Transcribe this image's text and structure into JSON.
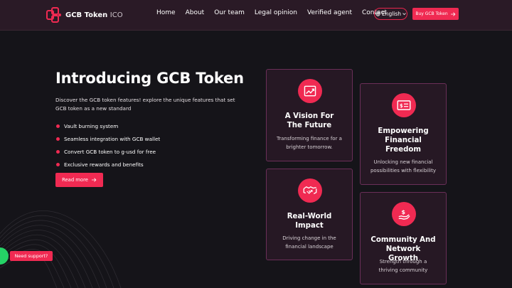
{
  "brand": {
    "name": "GCB Token",
    "suffix": "ICO"
  },
  "nav": {
    "items": [
      "Home",
      "About",
      "Our team",
      "Legal opinion",
      "Verified agent",
      "Contact"
    ]
  },
  "header": {
    "language": "English",
    "buy_label": "Buy GCB Token"
  },
  "hero": {
    "title": "Introducing GCB Token",
    "description": "Discover the GCB token features! explore the unique features that set GCB token as a new standard",
    "features": [
      "Vault burning system",
      "Seamless integration with GCB wallet",
      "Convert GCB token to g-usd for free",
      "Exclusive rewards and benefits"
    ],
    "read_more": "Read more"
  },
  "cards": [
    {
      "title": "A Vision For The Future",
      "text": "Transforming finance for a brighter tomorrow.",
      "icon": "trend-up-icon"
    },
    {
      "title": "Empowering Financial Freedom",
      "text": "Unlocking new financial possibilities with flexibility",
      "icon": "money-card-icon"
    },
    {
      "title": "Real-World Impact",
      "text": "Driving change in the financial landscape",
      "icon": "handshake-icon"
    },
    {
      "title": "Community And Network Growth",
      "text": "Strength through a thriving community",
      "icon": "dollar-hand-icon"
    }
  ],
  "support": {
    "label": "Need support?"
  },
  "colors": {
    "accent": "#f02a52",
    "background": "#151419",
    "card_bg": "#261824",
    "card_border": "#6a2f58",
    "header_bg": "#2a1a26",
    "support_green": "#25d366"
  }
}
